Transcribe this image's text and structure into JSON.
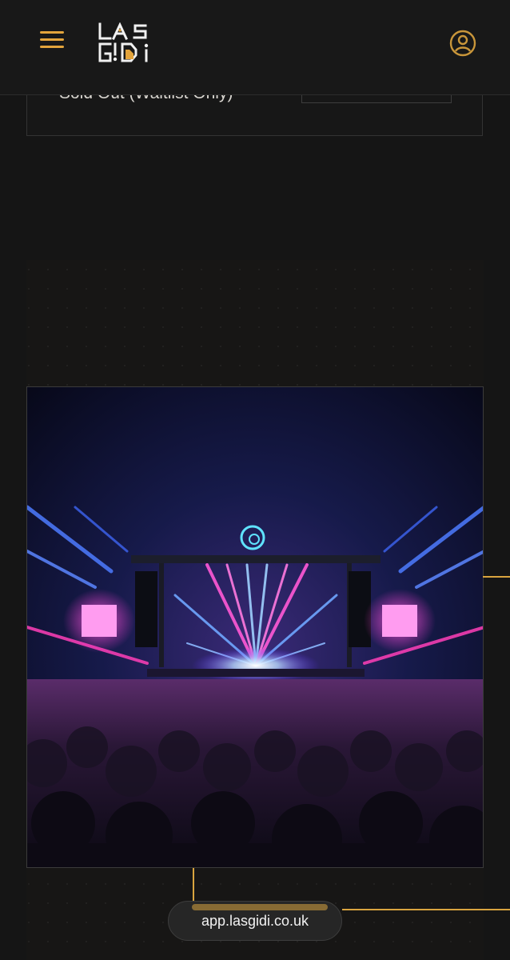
{
  "header": {
    "menu_icon": "hamburger-menu-icon",
    "logo_icon": "lasgidi-logo-icon",
    "profile_icon": "user-circle-icon",
    "accent_color": "#e3a43c"
  },
  "ticket": {
    "status_label": "Sold Out (Waitlist Only)"
  },
  "hero": {
    "image_icon": "concert-stage-image",
    "accent_color": "#d9a43f"
  },
  "browser": {
    "url": "app.lasgidi.co.uk"
  }
}
